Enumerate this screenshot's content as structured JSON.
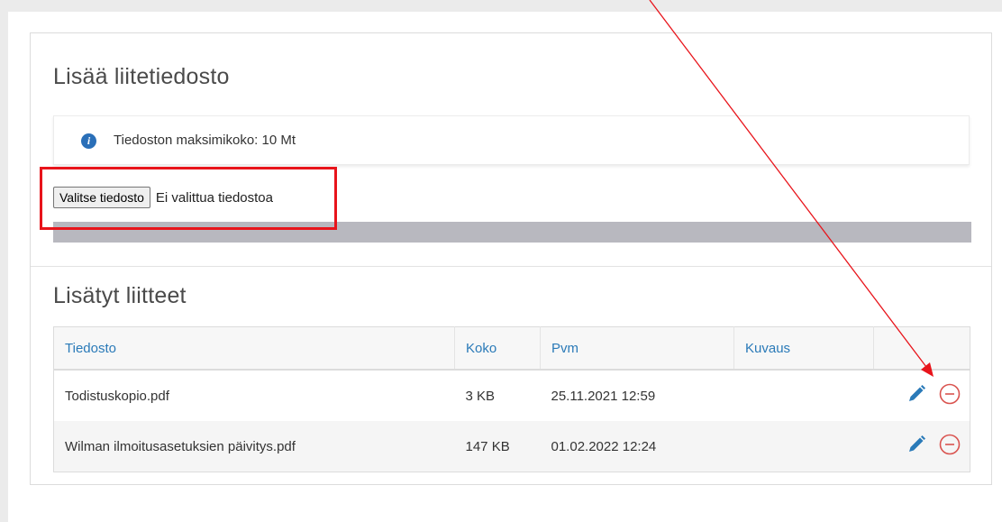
{
  "upload": {
    "title": "Lisää liitetiedosto",
    "info_text": "Tiedoston maksimikoko: 10 Mt",
    "info_icon": "info-icon",
    "choose_button": "Valitse tiedosto",
    "no_file_text": "Ei valittua tiedostoa"
  },
  "attachments": {
    "title": "Lisätyt liitteet",
    "columns": [
      "Tiedosto",
      "Koko",
      "Pvm",
      "Kuvaus",
      ""
    ],
    "rows": [
      {
        "file": "Todistuskopio.pdf",
        "size": "3 KB",
        "date": "25.11.2021 12:59",
        "description": ""
      },
      {
        "file": "Wilman ilmoitusasetuksien päivitys.pdf",
        "size": "147 KB",
        "date": "01.02.2022 12:24",
        "description": ""
      }
    ],
    "edit_icon": "pencil-icon",
    "remove_icon": "minus-circle-icon"
  },
  "colors": {
    "accent": "#2a7ab8",
    "remove": "#d9534f",
    "annotation": "#e8141b"
  }
}
